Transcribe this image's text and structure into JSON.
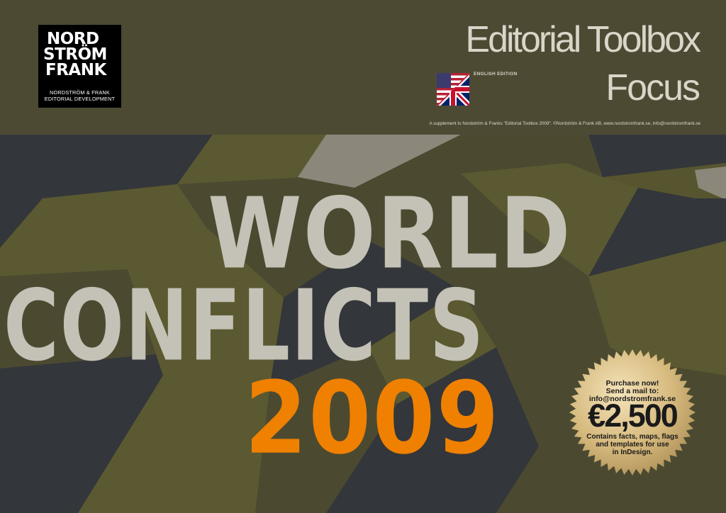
{
  "logo": {
    "line1": "NORD",
    "line2": "STRÖM",
    "line3": "FRANK",
    "sub1": "NORDSTRÖM & FRANK",
    "sub2": "EDITORIAL DEVELOPMENT"
  },
  "header": {
    "title": "Editorial Toolbox",
    "subtitle": "Focus",
    "edition": "ENGLISH EDITION",
    "supplement": "A supplement to Nordström & Franks \"Editorial Toolbox 2009\". ©Nordström & Frank AB, www.nordstromfrank.se, info@nordstromfrank.se"
  },
  "cover": {
    "line1": "WORLD",
    "line2": "CONFLICTS",
    "year": "2009"
  },
  "seal": {
    "cta1": "Purchase now!",
    "cta2": "Send a mail to:",
    "email": "info@nordstromfrank.se",
    "price": "€2,500",
    "note1": "Contains facts, maps, flags",
    "note2": "and templates for use",
    "note3": "in InDesign."
  },
  "colors": {
    "header_bg": "#4d4a34",
    "olive": "#5a5730",
    "dark_olive": "#4a4a30",
    "slate": "#33363a",
    "stone": "#8b877a",
    "headline": "#c4c1b6",
    "year": "#f08000",
    "seal_gold": "#c8a96a"
  },
  "icons": {
    "flag": "us-uk-flag-icon"
  }
}
